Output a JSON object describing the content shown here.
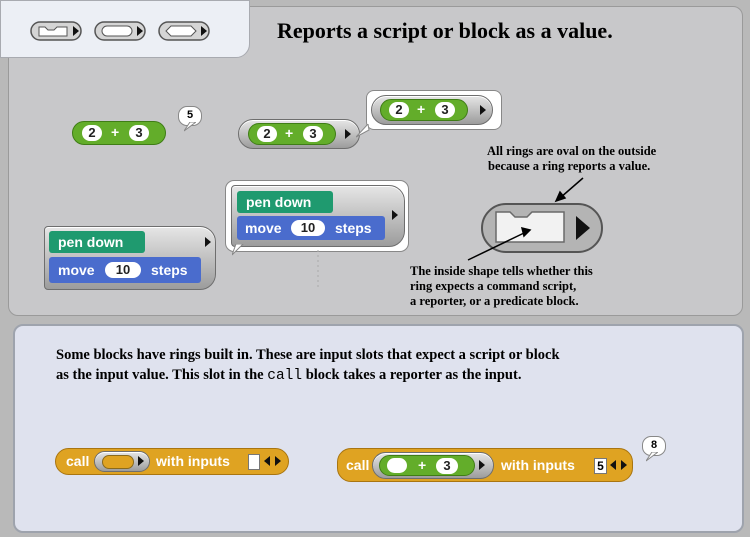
{
  "header": {
    "title": "Reports a script or block as a value."
  },
  "examples": {
    "ring_expr": {
      "a": "2",
      "op": "+",
      "b": "3"
    },
    "bubble_result": "5",
    "pen_block": {
      "pen_down": "pen down",
      "move": "move",
      "steps_value": "10",
      "steps": "steps"
    }
  },
  "notes": {
    "oval_line1": "All rings are oval on the outside",
    "oval_line2": "because a ring reports a value.",
    "shape_line1": "The inside shape tells whether this",
    "shape_line2": "ring expects a command script,",
    "shape_line3": "a reporter, or a predicate block."
  },
  "bottom": {
    "line1": "Some blocks have rings built in.  These are input slots that expect a script or block",
    "line2": "as the input value.  This slot in the",
    "line2_code": "call",
    "line2_end": "block takes a reporter as the input.",
    "call_label": "call",
    "with_inputs": "with inputs",
    "filled_input": "5",
    "filled_expr": {
      "op": "+",
      "b": "3"
    },
    "result": "8"
  },
  "colors": {
    "green": "#63ad2a",
    "teal": "#1f9a6f",
    "blue": "#4a6ccd",
    "orange": "#dfa322"
  },
  "icons": [
    "ring-command-icon",
    "ring-reporter-icon",
    "ring-predicate-icon",
    "arrow-right-icon",
    "arrow-left-icon"
  ]
}
